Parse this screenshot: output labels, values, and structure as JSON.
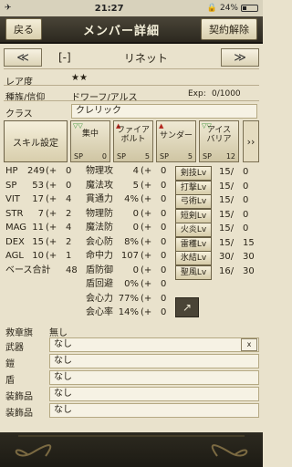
{
  "status": {
    "time": "21:27",
    "battery": "24%",
    "battery_level": 0.24
  },
  "header": {
    "back": "戻る",
    "title": "メンバー詳細",
    "dismiss": "契約解除"
  },
  "nav": {
    "prev": "≪",
    "next": "≫",
    "tag": "[-]",
    "name": "リネット"
  },
  "profile": {
    "rarity_label": "レア度",
    "rarity": "★★",
    "race_label": "種族/信仰",
    "race": "ドワーフ/アルス",
    "exp_label": "Exp:",
    "exp": "0/1000",
    "class_label": "クラス",
    "class": "クレリック"
  },
  "skills": {
    "button": "スキル設定",
    "cards": [
      {
        "name": "集中",
        "sp_label": "SP",
        "sp": "0",
        "mark": "▽▽",
        "mark_color": "green"
      },
      {
        "name": "ファイア\nボルト",
        "sp_label": "SP",
        "sp": "5",
        "mark": "▲",
        "mark_color": "red"
      },
      {
        "name": "サンダー",
        "sp_label": "SP",
        "sp": "5",
        "mark": "▲",
        "mark_color": "red"
      },
      {
        "name": "アイス\nバリア",
        "sp_label": "SP",
        "sp": "12",
        "mark": "▽▽",
        "mark_color": "green"
      }
    ],
    "more": "››"
  },
  "stats": [
    {
      "label": "HP",
      "value": "249",
      "plus": "(+",
      "bonus": "0"
    },
    {
      "label": "SP",
      "value": "53",
      "plus": "(+",
      "bonus": "0"
    },
    {
      "label": "VIT",
      "value": "17",
      "plus": "(+",
      "bonus": "4"
    },
    {
      "label": "STR",
      "value": "7",
      "plus": "(+",
      "bonus": "2"
    },
    {
      "label": "MAG",
      "value": "11",
      "plus": "(+",
      "bonus": "4"
    },
    {
      "label": "DEX",
      "value": "15",
      "plus": "(+",
      "bonus": "2"
    },
    {
      "label": "AGL",
      "value": "10",
      "plus": "(+",
      "bonus": "1"
    },
    {
      "label": "ベース合計",
      "value": "48",
      "plus": "",
      "bonus": ""
    }
  ],
  "combat": [
    {
      "label": "物理攻",
      "value": "4",
      "plus": "(+",
      "bonus": "0"
    },
    {
      "label": "魔法攻",
      "value": "5",
      "plus": "(+",
      "bonus": "0"
    },
    {
      "label": "貫通力",
      "value": "4%",
      "plus": "(+",
      "bonus": "0"
    },
    {
      "label": "物理防",
      "value": "0",
      "plus": "(+",
      "bonus": "0"
    },
    {
      "label": "魔法防",
      "value": "0",
      "plus": "(+",
      "bonus": "0"
    },
    {
      "label": "会心防",
      "value": "8%",
      "plus": "(+",
      "bonus": "0"
    },
    {
      "label": "命中力",
      "value": "107",
      "plus": "(+",
      "bonus": "0"
    },
    {
      "label": "盾防御",
      "value": "0",
      "plus": "(+",
      "bonus": "0"
    },
    {
      "label": "盾回避",
      "value": "0%",
      "plus": "(+",
      "bonus": "0"
    },
    {
      "label": "会心力",
      "value": "77%",
      "plus": "(+",
      "bonus": "0"
    },
    {
      "label": "会心率",
      "value": "14%",
      "plus": "(+",
      "bonus": "0"
    }
  ],
  "weapon_levels": [
    {
      "label": "剣技Lv",
      "value": "15/",
      "max": "0"
    },
    {
      "label": "打撃Lv",
      "value": "15/",
      "max": "0"
    },
    {
      "label": "弓術Lv",
      "value": "15/",
      "max": "0"
    },
    {
      "label": "短剣Lv",
      "value": "15/",
      "max": "0"
    },
    {
      "label": "火炎Lv",
      "value": "15/",
      "max": "0"
    },
    {
      "label": "雷穫Lv",
      "value": "15/",
      "max": "15"
    },
    {
      "label": "氷結Lv",
      "value": "30/",
      "max": "30"
    },
    {
      "label": "聖風Lv",
      "value": "16/",
      "max": "30"
    }
  ],
  "equipment": {
    "faction_label": "救章旗",
    "faction": "無し",
    "slots": [
      {
        "label": "武器",
        "value": "なし",
        "clear": "x"
      },
      {
        "label": "鎧",
        "value": "なし"
      },
      {
        "label": "盾",
        "value": "なし"
      },
      {
        "label": "装飾品",
        "value": "なし"
      },
      {
        "label": "装飾品",
        "value": "なし"
      }
    ]
  },
  "share_icon": "share-icon"
}
